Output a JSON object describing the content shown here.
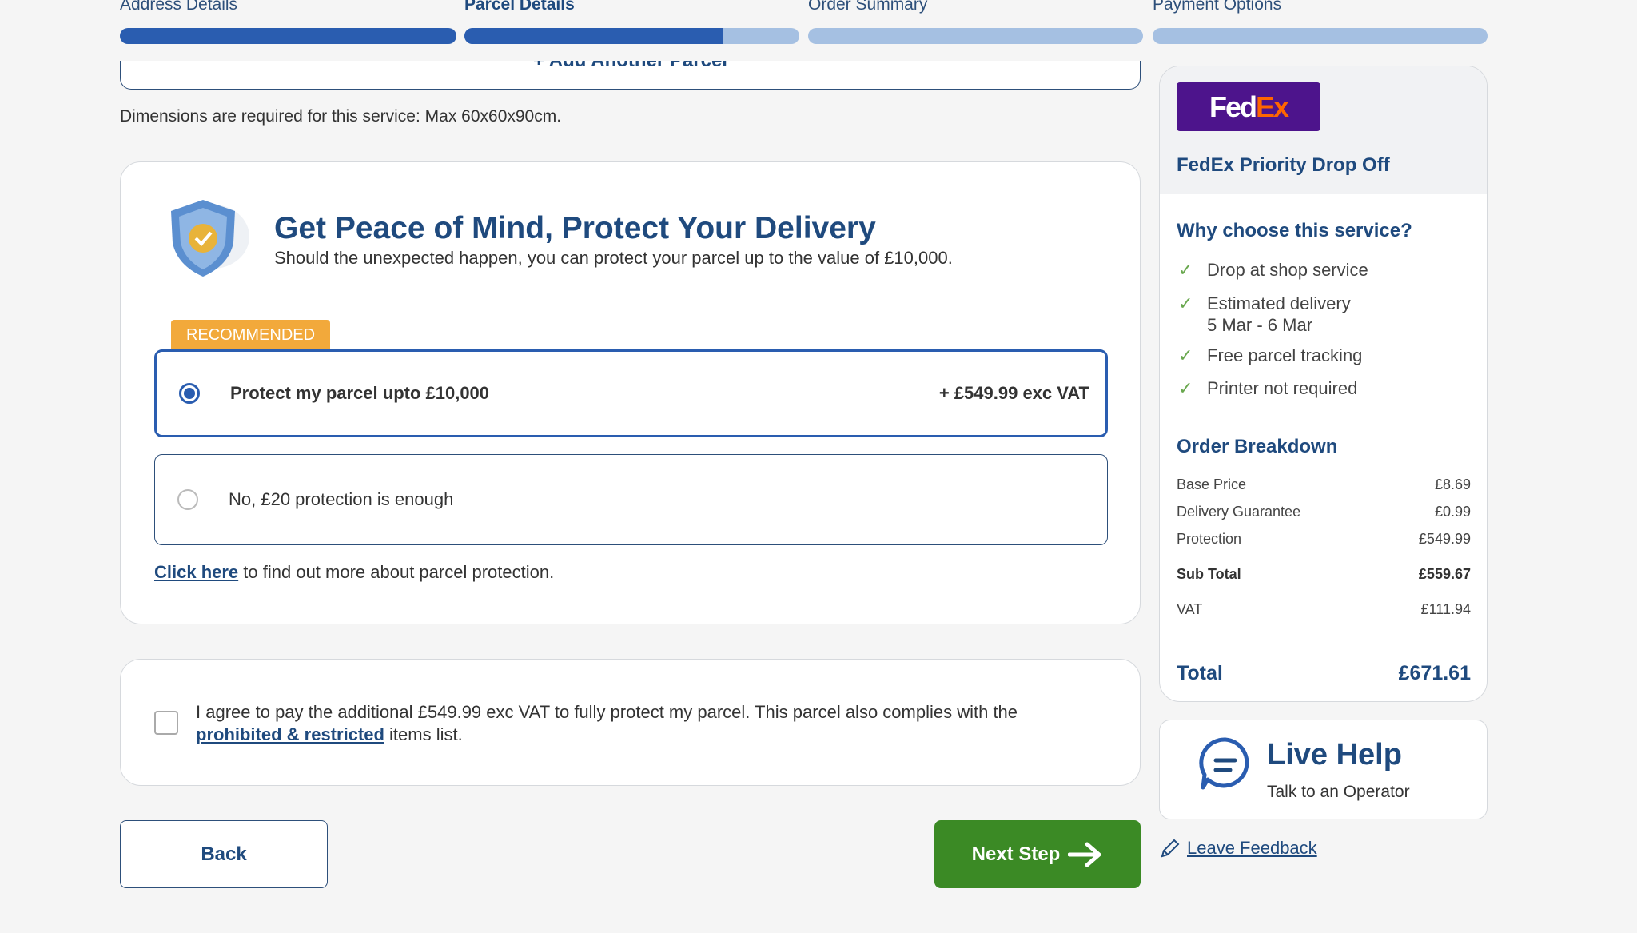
{
  "steps": [
    {
      "label": "Address Details",
      "progress": 100
    },
    {
      "label": "Parcel Details",
      "progress": 77
    },
    {
      "label": "Order Summary",
      "progress": 0
    },
    {
      "label": "Payment Options",
      "progress": 0
    }
  ],
  "add_parcel_label": "+ Add Another Parcel",
  "dimensions_note": "Dimensions are required for this service: Max 60x60x90cm.",
  "protection": {
    "title": "Get Peace of Mind, Protect Your Delivery",
    "subtitle": "Should the unexpected happen, you can protect your parcel up to the value of £10,000.",
    "badge": "RECOMMENDED",
    "options": [
      {
        "label": "Protect my parcel upto £10,000",
        "price": "+ £549.99 exc VAT",
        "selected": true
      },
      {
        "label": "No, £20 protection is enough",
        "selected": false
      }
    ],
    "link_text": "Click here",
    "link_suffix": " to find out more about parcel protection."
  },
  "agree": {
    "text": "I agree to pay the additional £549.99 exc VAT to fully protect my parcel. This parcel also complies with the ",
    "link": "prohibited & restricted",
    "suffix": " items list.",
    "checked": false
  },
  "buttons": {
    "back": "Back",
    "next": "Next Step"
  },
  "service": {
    "logo": "FedEx",
    "name": "FedEx Priority Drop Off",
    "why_title": "Why choose this service?",
    "features": [
      "Drop at shop service",
      "Estimated delivery\n5 Mar - 6 Mar",
      "Free parcel tracking",
      "Printer not required"
    ],
    "breakdown_title": "Order Breakdown",
    "rows": [
      {
        "label": "Base Price",
        "value": "£8.69"
      },
      {
        "label": "Delivery Guarantee",
        "value": "£0.99"
      },
      {
        "label": "Protection",
        "value": "£549.99"
      },
      {
        "label": "Sub Total",
        "value": "£559.67"
      },
      {
        "label": "VAT",
        "value": "£111.94"
      }
    ],
    "total_label": "Total",
    "total_value": "£671.61"
  },
  "help": {
    "title": "Live Help",
    "subtitle": "Talk to an Operator",
    "feedback": "Leave Feedback"
  },
  "colors": {
    "primary": "#2a5db0",
    "navy": "#1f4a7e",
    "green": "#3b8a25",
    "badge": "#f2a93b",
    "fedex_purple": "#4d148c",
    "fedex_orange": "#ff6600"
  }
}
